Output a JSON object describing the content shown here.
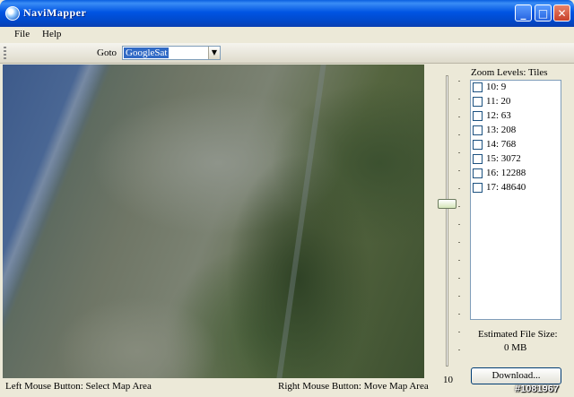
{
  "window": {
    "title": "NaviMapper"
  },
  "menu": {
    "items": [
      "File",
      "Help"
    ]
  },
  "toolbar": {
    "goto_label": "Goto",
    "goto_value": "GoogleSat"
  },
  "status": {
    "left": "Left Mouse Button: Select Map Area",
    "right": "Right Mouse Button: Move Map Area"
  },
  "zoom": {
    "title": "Zoom Levels: Tiles",
    "levels": [
      "10: 9",
      "11: 20",
      "12: 63",
      "13: 208",
      "14: 768",
      "15: 3072",
      "16: 12288",
      "17: 48640"
    ],
    "slider_value": "10"
  },
  "estimate": {
    "label": "Estimated File Size:",
    "value": "0 MB"
  },
  "download_label": "Download...",
  "watermark": "#1081967",
  "colors": {
    "titlebar": "#0054E3",
    "selection": "#316AC5",
    "window_bg": "#ECE9D8"
  }
}
